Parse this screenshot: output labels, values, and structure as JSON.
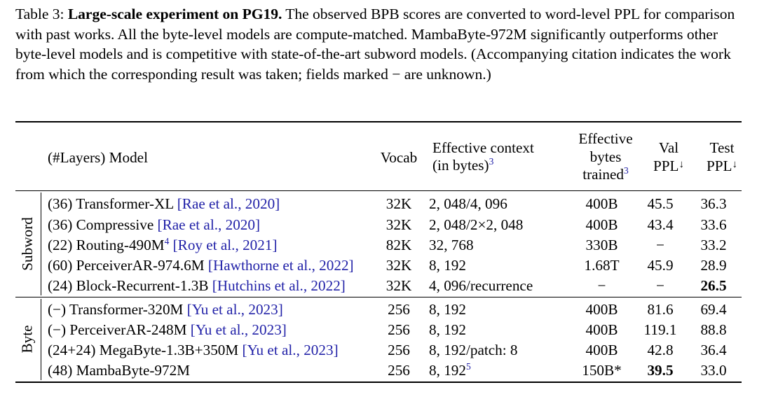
{
  "caption": {
    "label": "Table 3:",
    "bold_title": "Large-scale experiment on PG19.",
    "body": "The observed BPB scores are converted to word-level PPL for comparison with past works. All the byte-level models are compute-matched. MambaByte-972M significantly outperforms other byte-level models and is competitive with state-of-the-art subword models. (Accompanying citation indicates the work from which the corresponding result was taken; fields marked − are unknown.)"
  },
  "table": {
    "headers": {
      "model": "(#Layers) Model",
      "vocab": "Vocab",
      "context_line1": "Effective context",
      "context_line2": "(in bytes)",
      "context_sup": "3",
      "bytes_line1": "Effective",
      "bytes_line2": "bytes",
      "bytes_line3": "trained",
      "bytes_sup": "3",
      "val_line1": "Val",
      "val_line2": "PPL",
      "val_arrow": "↓",
      "test_line1": "Test",
      "test_line2": "PPL",
      "test_arrow": "↓"
    },
    "groups": [
      {
        "label": "Subword",
        "rows": [
          {
            "layers": "(36)",
            "model_name": "Transformer-XL",
            "citation": "[Rae et al., 2020]",
            "model_sup": "",
            "vocab": "32K",
            "context": "2, 048/4, 096",
            "context_sup": "",
            "bytes": "400B",
            "val": "45.5",
            "test": "36.3",
            "val_bold": false,
            "test_bold": false
          },
          {
            "layers": "(36)",
            "model_name": "Compressive",
            "citation": "[Rae et al., 2020]",
            "model_sup": "",
            "vocab": "32K",
            "context": "2, 048/2×2, 048",
            "context_sup": "",
            "bytes": "400B",
            "val": "43.4",
            "test": "33.6",
            "val_bold": false,
            "test_bold": false
          },
          {
            "layers": "(22)",
            "model_name": "Routing-490M",
            "citation": "[Roy et al., 2021]",
            "model_sup": "4",
            "vocab": "82K",
            "context": "32, 768",
            "context_sup": "",
            "bytes": "330B",
            "val": "−",
            "test": "33.2",
            "val_bold": false,
            "test_bold": false
          },
          {
            "layers": "(60)",
            "model_name": "PerceiverAR-974.6M",
            "citation": "[Hawthorne et al., 2022]",
            "model_sup": "",
            "vocab": "32K",
            "context": "8, 192",
            "context_sup": "",
            "bytes": "1.68T",
            "val": "45.9",
            "test": "28.9",
            "val_bold": false,
            "test_bold": false
          },
          {
            "layers": "(24)",
            "model_name": "Block-Recurrent-1.3B",
            "citation": "[Hutchins et al., 2022]",
            "model_sup": "",
            "vocab": "32K",
            "context": "4, 096/recurrence",
            "context_sup": "",
            "bytes": "−",
            "val": "−",
            "test": "26.5",
            "val_bold": false,
            "test_bold": true
          }
        ]
      },
      {
        "label": "Byte",
        "rows": [
          {
            "layers": "(−)",
            "model_name": "Transformer-320M",
            "citation": "[Yu et al., 2023]",
            "model_sup": "",
            "vocab": "256",
            "context": "8, 192",
            "context_sup": "",
            "bytes": "400B",
            "val": "81.6",
            "test": "69.4",
            "val_bold": false,
            "test_bold": false
          },
          {
            "layers": "(−)",
            "model_name": "PerceiverAR-248M",
            "citation": "[Yu et al., 2023]",
            "model_sup": "",
            "vocab": "256",
            "context": "8, 192",
            "context_sup": "",
            "bytes": "400B",
            "val": "119.1",
            "test": "88.8",
            "val_bold": false,
            "test_bold": false
          },
          {
            "layers": "(24+24)",
            "model_name": "MegaByte-1.3B+350M",
            "citation": "[Yu et al., 2023]",
            "model_sup": "",
            "vocab": "256",
            "context": "8, 192/patch: 8",
            "context_sup": "",
            "bytes": "400B",
            "val": "42.8",
            "test": "36.4",
            "val_bold": false,
            "test_bold": false
          },
          {
            "layers": "(48)",
            "model_name": "MambaByte-972M",
            "citation": "",
            "model_sup": "",
            "vocab": "256",
            "context": "8, 192",
            "context_sup": "5",
            "bytes": "150B*",
            "val": "39.5",
            "test": "33.0",
            "val_bold": true,
            "test_bold": false
          }
        ]
      }
    ]
  },
  "colors": {
    "citation_link": "#2222a8",
    "rule": "#000000",
    "text": "#000000"
  }
}
